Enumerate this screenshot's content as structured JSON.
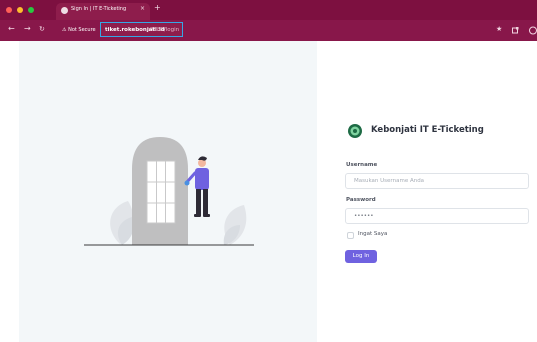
{
  "browser": {
    "tab_title": "Sign In | IT E-Ticketing",
    "tab_close": "×",
    "new_tab": "+",
    "not_secure": "Not Secure",
    "url_host": "tiket.rokebonjati.id",
    "url_path": ":8888/login",
    "window_controls": {
      "close": "#ff5f57",
      "minimize": "#febc2e",
      "maximize": "#28c840"
    }
  },
  "login": {
    "brand": "Kebonjati IT E-Ticketing",
    "username_label": "Username",
    "username_placeholder": "Masukan Username Anda",
    "password_label": "Password",
    "password_value": "••••••",
    "remember_label": "Ingat Saya",
    "login_button": "Log In"
  },
  "colors": {
    "browser_frame": "#7d1040",
    "accent": "#6f62e0",
    "url_focus": "#35a7e6"
  }
}
